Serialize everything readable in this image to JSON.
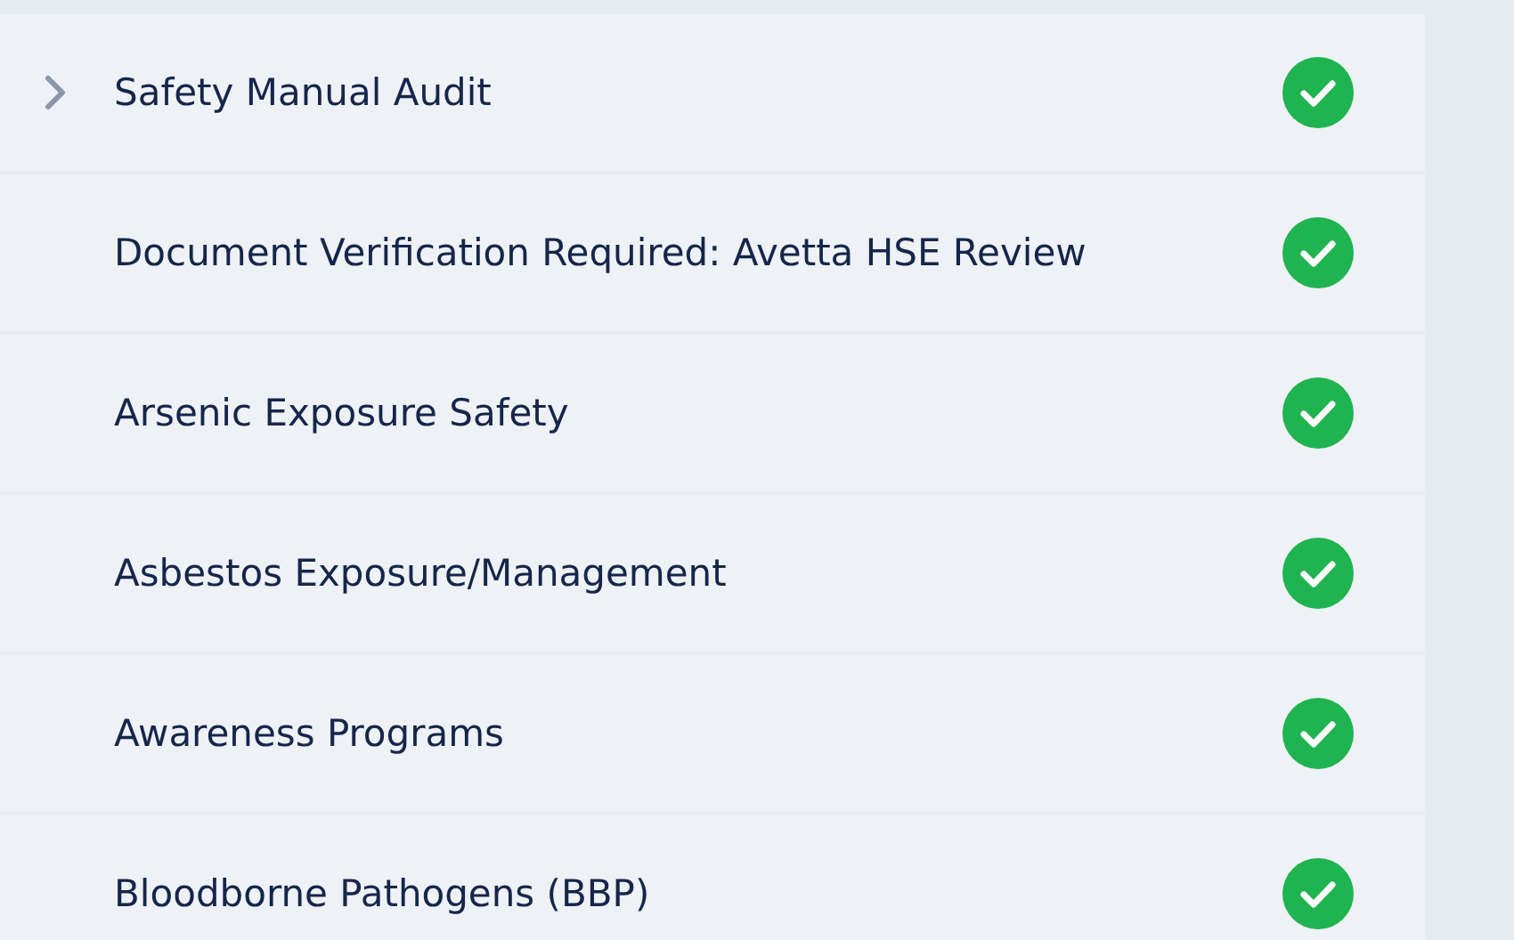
{
  "items": [
    {
      "title": "Safety Manual Audit",
      "expandable": true,
      "completed": true
    },
    {
      "title": "Document Verification Required: Avetta HSE Review",
      "expandable": false,
      "completed": true
    },
    {
      "title": "Arsenic Exposure Safety",
      "expandable": false,
      "completed": true
    },
    {
      "title": "Asbestos Exposure/Management",
      "expandable": false,
      "completed": true
    },
    {
      "title": "Awareness Programs",
      "expandable": false,
      "completed": true
    },
    {
      "title": "Bloodborne Pathogens (BBP)",
      "expandable": false,
      "completed": true
    }
  ]
}
